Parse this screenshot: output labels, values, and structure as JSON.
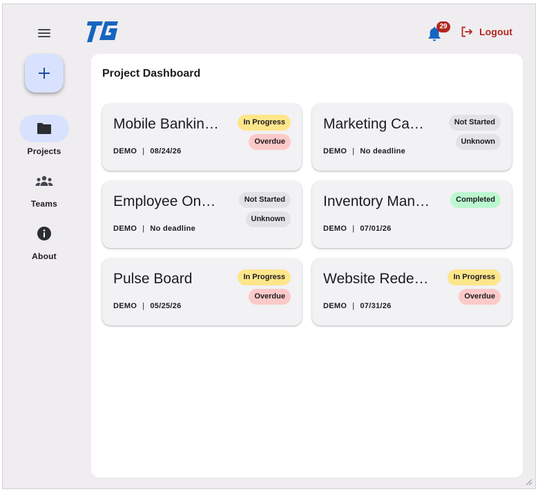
{
  "nav": {
    "items": [
      {
        "label": "Projects",
        "icon": "folder-icon"
      },
      {
        "label": "Teams",
        "icon": "groups-icon"
      },
      {
        "label": "About",
        "icon": "info-icon"
      }
    ]
  },
  "header": {
    "logo_text": "TG",
    "notifications_count": "29",
    "logout_label": "Logout"
  },
  "main": {
    "title": "Project Dashboard",
    "projects": [
      {
        "title": "Mobile Banking App",
        "org": "DEMO",
        "date": "08/24/26",
        "status": "In Progress",
        "status_type": "in-progress",
        "flag": "Overdue",
        "flag_type": "overdue"
      },
      {
        "title": "Marketing Campaign",
        "org": "DEMO",
        "date": "No deadline",
        "status": "Not Started",
        "status_type": "not-started",
        "flag": "Unknown",
        "flag_type": "unknown"
      },
      {
        "title": "Employee Onboarding",
        "org": "DEMO",
        "date": "No deadline",
        "status": "Not Started",
        "status_type": "not-started",
        "flag": "Unknown",
        "flag_type": "unknown"
      },
      {
        "title": "Inventory Management",
        "org": "DEMO",
        "date": "07/01/26",
        "status": "Completed",
        "status_type": "completed",
        "flag": "",
        "flag_type": ""
      },
      {
        "title": "Pulse Board",
        "org": "DEMO",
        "date": "05/25/26",
        "status": "In Progress",
        "status_type": "in-progress",
        "flag": "Overdue",
        "flag_type": "overdue"
      },
      {
        "title": "Website Redesign",
        "org": "DEMO",
        "date": "07/31/26",
        "status": "In Progress",
        "status_type": "in-progress",
        "flag": "Overdue",
        "flag_type": "overdue"
      }
    ]
  },
  "colors": {
    "accent": "#1565c0",
    "fab_background": "#d8e2ff",
    "danger": "#b3261e",
    "panel_background": "#ffffff",
    "frame_background": "#efedf0"
  }
}
